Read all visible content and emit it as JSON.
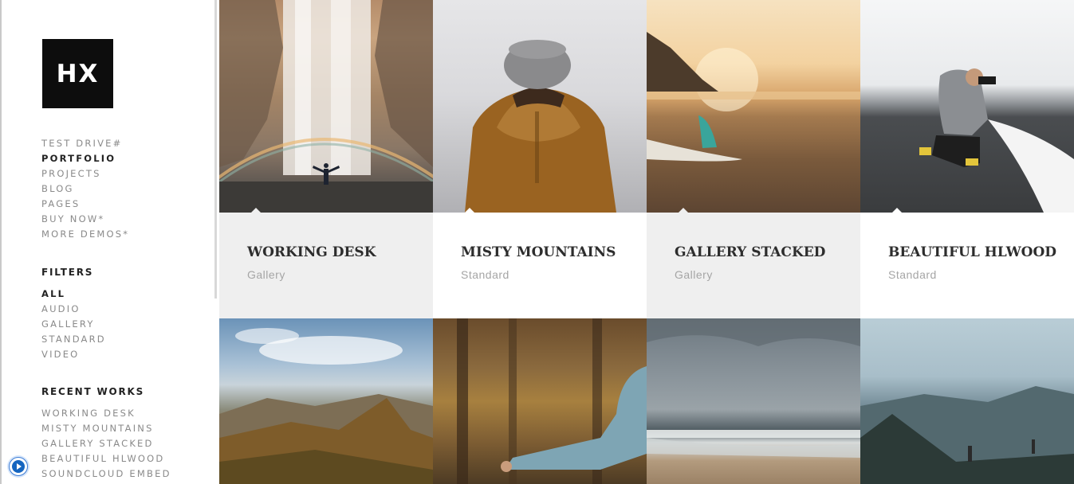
{
  "logo": {
    "text": "HX"
  },
  "nav": {
    "items": [
      {
        "label": "TEST DRIVE#"
      },
      {
        "label": "PORTFOLIO"
      },
      {
        "label": "PROJECTS"
      },
      {
        "label": "BLOG"
      },
      {
        "label": "PAGES"
      },
      {
        "label": "BUY NOW*"
      },
      {
        "label": "MORE DEMOS*"
      }
    ],
    "active": "PORTFOLIO"
  },
  "filters": {
    "title": "FILTERS",
    "items": [
      {
        "label": "ALL"
      },
      {
        "label": "AUDIO"
      },
      {
        "label": "GALLERY"
      },
      {
        "label": "STANDARD"
      },
      {
        "label": "VIDEO"
      }
    ],
    "active": "ALL"
  },
  "recent": {
    "title": "RECENT WORKS",
    "items": [
      {
        "label": "WORKING DESK"
      },
      {
        "label": "MISTY MOUNTAINS"
      },
      {
        "label": "GALLERY STACKED"
      },
      {
        "label": "BEAUTIFUL HLWOOD"
      },
      {
        "label": "SOUNDCLOUD EMBED"
      }
    ]
  },
  "portfolio": {
    "items": [
      {
        "title": "WORKING DESK",
        "category": "Gallery",
        "info_bg": "#efefef",
        "image": "waterfall"
      },
      {
        "title": "MISTY MOUNTAINS",
        "category": "Standard",
        "info_bg": "#ffffff",
        "image": "misty"
      },
      {
        "title": "GALLERY STACKED",
        "category": "Gallery",
        "info_bg": "#efefef",
        "image": "beach"
      },
      {
        "title": "BEAUTIFUL HLWOOD",
        "category": "Standard",
        "info_bg": "#ffffff",
        "image": "photographer"
      }
    ],
    "row2_images": [
      "mountains",
      "forest",
      "sea",
      "valley"
    ]
  },
  "colors": {
    "accent": "#222222",
    "muted": "#8a8a8a",
    "info_alt": "#efefef"
  }
}
